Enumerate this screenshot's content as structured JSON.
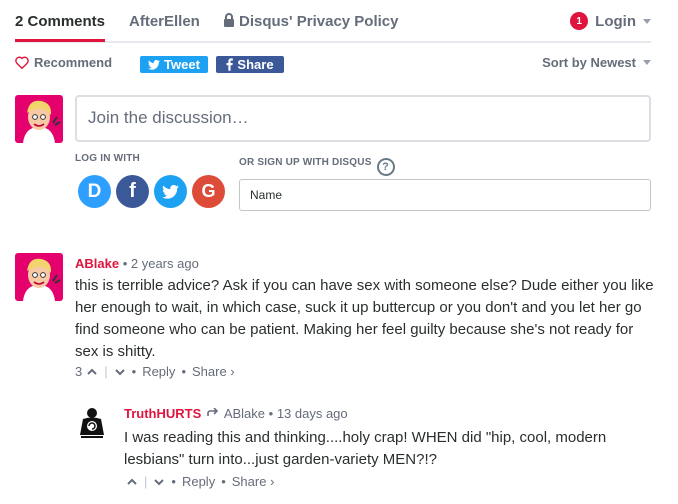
{
  "nav": {
    "comments_tab": "2 Comments",
    "site_tab": "AfterEllen",
    "privacy_tab": "Disqus' Privacy Policy",
    "login_label": "Login",
    "notification_count": "1"
  },
  "actions": {
    "recommend_label": "Recommend",
    "tweet_label": "Tweet",
    "share_label": "Share",
    "sort_label": "Sort by Newest"
  },
  "compose": {
    "placeholder": "Join the discussion…",
    "log_in_with": "LOG IN WITH",
    "sign_up_label": "OR SIGN UP WITH DISQUS",
    "help_label": "?",
    "name_placeholder": "Name",
    "providers": [
      "D",
      "f",
      "twitter",
      "G"
    ]
  },
  "comments": [
    {
      "author": "ABlake",
      "time": "2 years ago",
      "body": "this is terrible advice? Ask if you can have sex with someone else? Dude either you like her enough to wait, in which case, suck it up buttercup or you don't and you let her go find someone who can be patient. Making her feel guilty because she's not ready for sex is shitty.",
      "votes": "3",
      "reply": "Reply",
      "share": "Share ›"
    },
    {
      "author": "TruthHURTS",
      "reply_to": "ABlake",
      "time": "13 days ago",
      "body": "I was reading this and thinking....holy crap! WHEN did \"hip, cool, modern lesbians\" turn into...just garden-variety MEN?!?",
      "votes": "",
      "reply": "Reply",
      "share": "Share ›"
    }
  ],
  "colors": {
    "accent": "#e0153e",
    "twitter": "#1da1f2",
    "facebook": "#3b5998",
    "disqus": "#2e9fff",
    "google": "#dd4b39"
  }
}
